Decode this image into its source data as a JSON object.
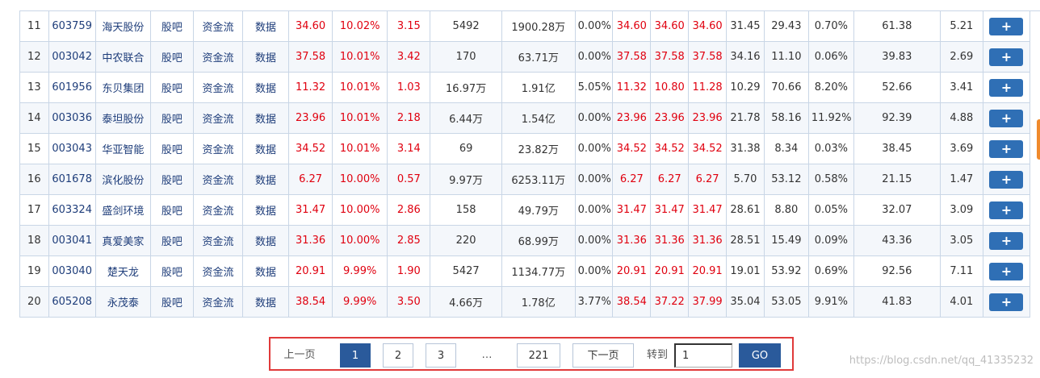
{
  "table": {
    "rows": [
      {
        "no": "11",
        "code": "603759",
        "name": "海天股份",
        "guba": "股吧",
        "fund": "资金流",
        "data": "数据",
        "price": "34.60",
        "pct": "10.02%",
        "chg": "3.15",
        "vol": "5492",
        "amount": "1900.28万",
        "amp": "0.00%",
        "high": "34.60",
        "low": "34.60",
        "open": "34.60",
        "prev": "31.45",
        "ratio": "29.43",
        "turnover": "0.70%",
        "pe": "61.38",
        "pb": "5.21"
      },
      {
        "no": "12",
        "code": "003042",
        "name": "中农联合",
        "guba": "股吧",
        "fund": "资金流",
        "data": "数据",
        "price": "37.58",
        "pct": "10.01%",
        "chg": "3.42",
        "vol": "170",
        "amount": "63.71万",
        "amp": "0.00%",
        "high": "37.58",
        "low": "37.58",
        "open": "37.58",
        "prev": "34.16",
        "ratio": "11.10",
        "turnover": "0.06%",
        "pe": "39.83",
        "pb": "2.69"
      },
      {
        "no": "13",
        "code": "601956",
        "name": "东贝集团",
        "guba": "股吧",
        "fund": "资金流",
        "data": "数据",
        "price": "11.32",
        "pct": "10.01%",
        "chg": "1.03",
        "vol": "16.97万",
        "amount": "1.91亿",
        "amp": "5.05%",
        "high": "11.32",
        "low": "10.80",
        "open": "11.28",
        "prev": "10.29",
        "ratio": "70.66",
        "turnover": "8.20%",
        "pe": "52.66",
        "pb": "3.41"
      },
      {
        "no": "14",
        "code": "003036",
        "name": "泰坦股份",
        "guba": "股吧",
        "fund": "资金流",
        "data": "数据",
        "price": "23.96",
        "pct": "10.01%",
        "chg": "2.18",
        "vol": "6.44万",
        "amount": "1.54亿",
        "amp": "0.00%",
        "high": "23.96",
        "low": "23.96",
        "open": "23.96",
        "prev": "21.78",
        "ratio": "58.16",
        "turnover": "11.92%",
        "pe": "92.39",
        "pb": "4.88"
      },
      {
        "no": "15",
        "code": "003043",
        "name": "华亚智能",
        "guba": "股吧",
        "fund": "资金流",
        "data": "数据",
        "price": "34.52",
        "pct": "10.01%",
        "chg": "3.14",
        "vol": "69",
        "amount": "23.82万",
        "amp": "0.00%",
        "high": "34.52",
        "low": "34.52",
        "open": "34.52",
        "prev": "31.38",
        "ratio": "8.34",
        "turnover": "0.03%",
        "pe": "38.45",
        "pb": "3.69"
      },
      {
        "no": "16",
        "code": "601678",
        "name": "滨化股份",
        "guba": "股吧",
        "fund": "资金流",
        "data": "数据",
        "price": "6.27",
        "pct": "10.00%",
        "chg": "0.57",
        "vol": "9.97万",
        "amount": "6253.11万",
        "amp": "0.00%",
        "high": "6.27",
        "low": "6.27",
        "open": "6.27",
        "prev": "5.70",
        "ratio": "53.12",
        "turnover": "0.58%",
        "pe": "21.15",
        "pb": "1.47"
      },
      {
        "no": "17",
        "code": "603324",
        "name": "盛剑环境",
        "guba": "股吧",
        "fund": "资金流",
        "data": "数据",
        "price": "31.47",
        "pct": "10.00%",
        "chg": "2.86",
        "vol": "158",
        "amount": "49.79万",
        "amp": "0.00%",
        "high": "31.47",
        "low": "31.47",
        "open": "31.47",
        "prev": "28.61",
        "ratio": "8.80",
        "turnover": "0.05%",
        "pe": "32.07",
        "pb": "3.09"
      },
      {
        "no": "18",
        "code": "003041",
        "name": "真爱美家",
        "guba": "股吧",
        "fund": "资金流",
        "data": "数据",
        "price": "31.36",
        "pct": "10.00%",
        "chg": "2.85",
        "vol": "220",
        "amount": "68.99万",
        "amp": "0.00%",
        "high": "31.36",
        "low": "31.36",
        "open": "31.36",
        "prev": "28.51",
        "ratio": "15.49",
        "turnover": "0.09%",
        "pe": "43.36",
        "pb": "3.05"
      },
      {
        "no": "19",
        "code": "003040",
        "name": "楚天龙",
        "guba": "股吧",
        "fund": "资金流",
        "data": "数据",
        "price": "20.91",
        "pct": "9.99%",
        "chg": "1.90",
        "vol": "5427",
        "amount": "1134.77万",
        "amp": "0.00%",
        "high": "20.91",
        "low": "20.91",
        "open": "20.91",
        "prev": "19.01",
        "ratio": "53.92",
        "turnover": "0.69%",
        "pe": "92.56",
        "pb": "7.11"
      },
      {
        "no": "20",
        "code": "605208",
        "name": "永茂泰",
        "guba": "股吧",
        "fund": "资金流",
        "data": "数据",
        "price": "38.54",
        "pct": "9.99%",
        "chg": "3.50",
        "vol": "4.66万",
        "amount": "1.78亿",
        "amp": "3.77%",
        "high": "38.54",
        "low": "37.22",
        "open": "37.99",
        "prev": "35.04",
        "ratio": "53.05",
        "turnover": "9.91%",
        "pe": "41.83",
        "pb": "4.01"
      }
    ],
    "add_glyph": "+",
    "add_icon": "plus-icon"
  },
  "pager": {
    "prev": "上一页",
    "pages": [
      "1",
      "2",
      "3"
    ],
    "ellipsis": "…",
    "last": "221",
    "next": "下一页",
    "jump_label": "转到",
    "jump_value": "1",
    "go": "GO"
  },
  "watermark": "https://blog.csdn.net/qq_41335232",
  "colors": {
    "rise": "#e0000f",
    "link": "#1e3d7a",
    "button": "#2f6fb5",
    "highlight": "#e03a3a"
  }
}
